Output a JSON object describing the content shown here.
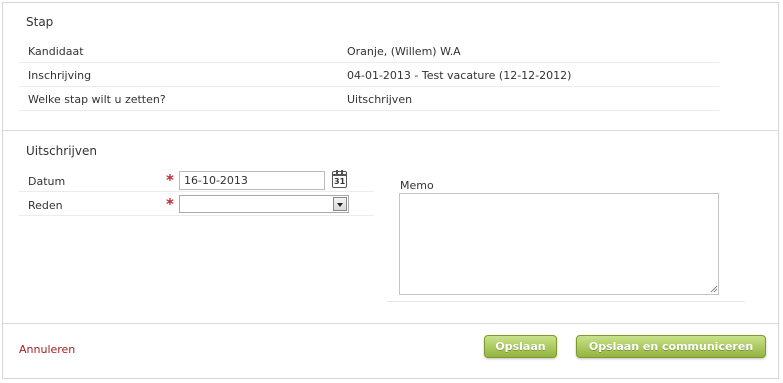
{
  "stap": {
    "title": "Stap",
    "rows": [
      {
        "label": "Kandidaat",
        "value": "Oranje, (Willem) W.A"
      },
      {
        "label": "Inschrijving",
        "value": "04-01-2013 - Test vacature (12-12-2012)"
      },
      {
        "label": "Welke stap wilt u zetten?",
        "value": "Uitschrijven"
      }
    ]
  },
  "uitschrijven": {
    "title": "Uitschrijven",
    "datum_label": "Datum",
    "datum_value": "16-10-2013",
    "reden_label": "Reden",
    "reden_value": "",
    "required_mark": "*",
    "calendar_day": "31",
    "memo_label": "Memo",
    "memo_value": ""
  },
  "footer": {
    "cancel_label": "Annuleren",
    "save_label": "Opslaan",
    "save_communicate_label": "Opslaan en communiceren"
  },
  "colors": {
    "cancel_link": "#a02224",
    "required": "#c0282d",
    "button_green": "#93b43f"
  }
}
